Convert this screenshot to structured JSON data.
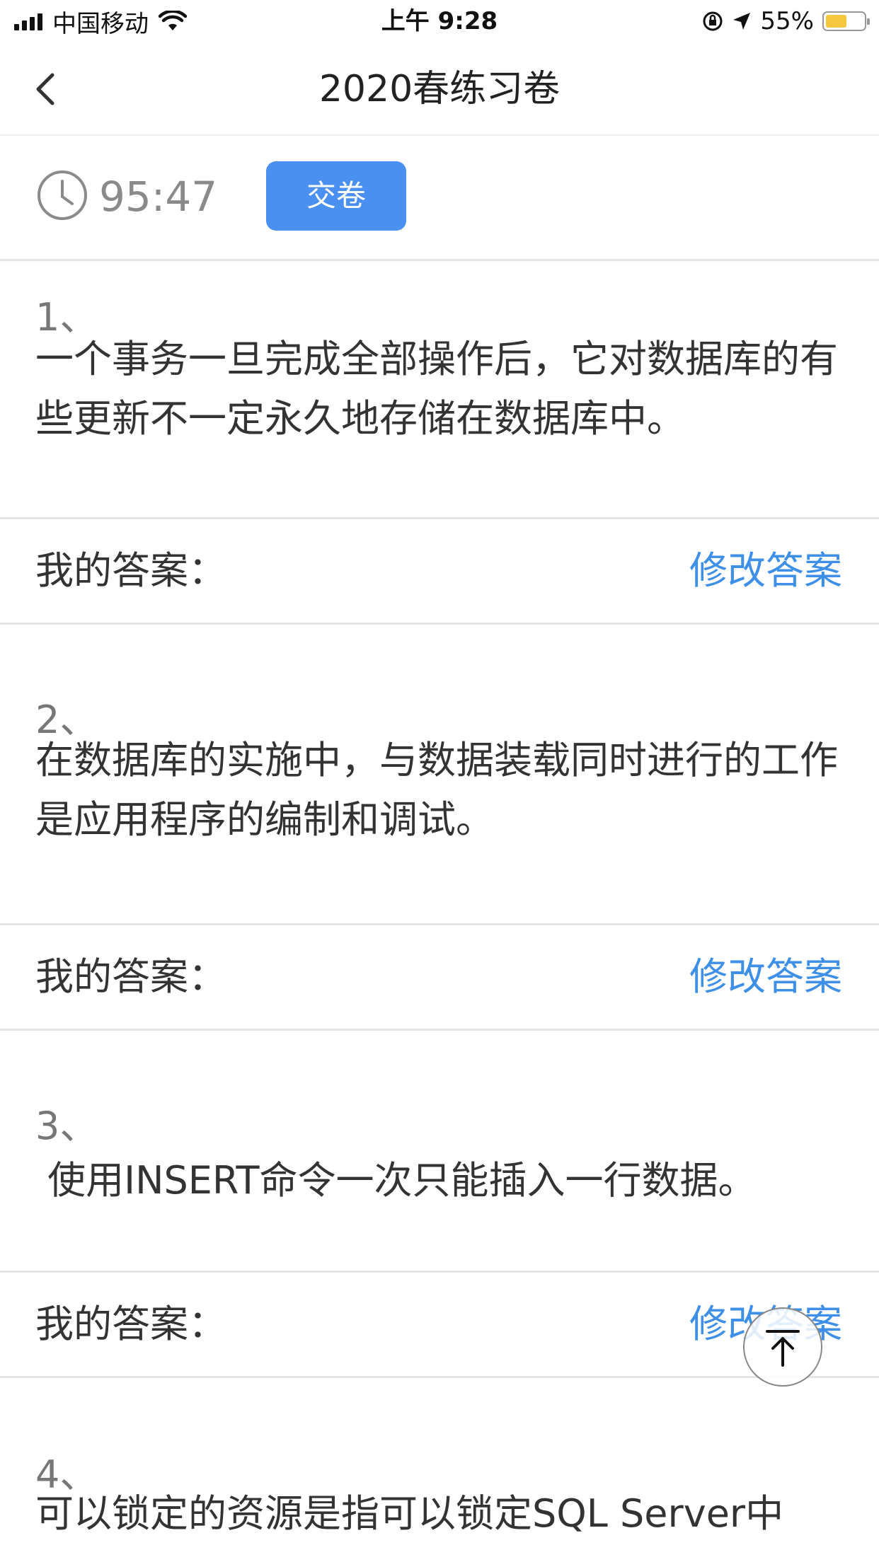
{
  "status_bar": {
    "carrier": "中国移动",
    "time": "上午 9:28",
    "battery": "55%",
    "battery_level": 0.55,
    "battery_color": "#f6c83f"
  },
  "nav": {
    "back_icon": "chevron-left-icon",
    "title": "2020春练习卷"
  },
  "timer": {
    "icon": "clock-icon",
    "remaining": "95:47",
    "submit_label": "交卷",
    "accent": "#4a90f0"
  },
  "questions": [
    {
      "number": "1、",
      "text": "一个事务一旦完成全部操作后，它对数据库的有些更新不一定永久地存储在数据库中。",
      "answer_label": "我的答案：",
      "edit_label": "修改答案"
    },
    {
      "number": "2、",
      "text": "在数据库的实施中，与数据装载同时进行的工作是应用程序的编制和调试。",
      "answer_label": "我的答案：",
      "edit_label": "修改答案"
    },
    {
      "number": "3、",
      "text": " 使用INSERT命令一次只能插入一行数据。",
      "answer_label": "我的答案：",
      "edit_label": "修改答案"
    },
    {
      "number": "4、",
      "text": "可以锁定的资源是指可以锁定SQL Server中"
    }
  ],
  "link_color": "#3d8fe8",
  "scroll_top_icon": "arrow-up-to-top-icon"
}
